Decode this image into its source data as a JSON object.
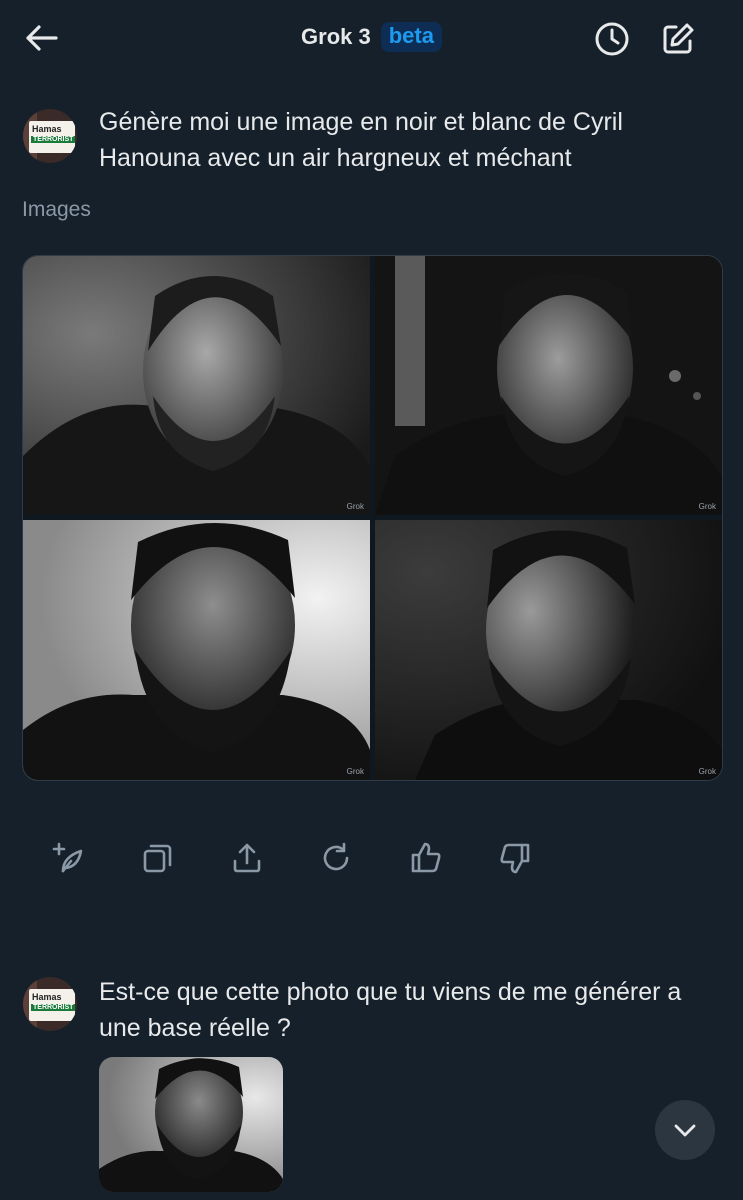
{
  "header": {
    "title": "Grok 3",
    "badge": "beta"
  },
  "messages": [
    {
      "text": "Génère moi une image en noir et blanc de Cyril Hanouna avec un air hargneux et méchant"
    },
    {
      "text": "Est-ce que cette photo que tu viens de me générer a une base réelle ?"
    }
  ],
  "avatar": {
    "sign_line1": "Hamas",
    "sign_line2": "TERRORIST"
  },
  "results": {
    "label": "Images",
    "watermark": "Grok"
  },
  "icons": {
    "back": "arrow-left-icon",
    "history": "clock-icon",
    "new_chat": "compose-icon",
    "actions": [
      "post-icon",
      "copy-icon",
      "share-icon",
      "regenerate-icon",
      "thumbs-up-icon",
      "thumbs-down-icon"
    ],
    "scroll": "chevron-down-icon"
  },
  "colors": {
    "background": "#15202b",
    "accent": "#1d9bf0",
    "muted": "#8b98a5"
  }
}
